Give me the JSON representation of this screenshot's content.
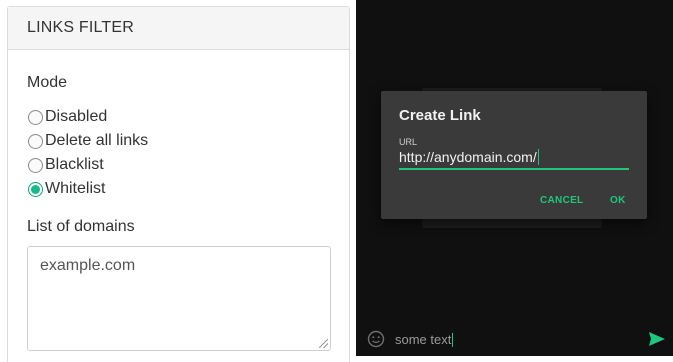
{
  "links_filter": {
    "title": "LINKS FILTER",
    "mode_label": "Mode",
    "modes": [
      {
        "label": "Disabled",
        "checked": false
      },
      {
        "label": "Delete all links",
        "checked": false
      },
      {
        "label": "Blacklist",
        "checked": false
      },
      {
        "label": "Whitelist",
        "checked": true
      }
    ],
    "domains_label": "List of domains",
    "domains_value": "example.com"
  },
  "android": {
    "dialog": {
      "title": "Create Link",
      "url_label": "URL",
      "url_value": "http://anydomain.com/",
      "cancel_label": "CANCEL",
      "ok_label": "OK"
    },
    "composer": {
      "text": "some text",
      "emoji_icon": "emoji-icon",
      "send_icon": "send-icon"
    },
    "accent_color": "#1ec77d"
  }
}
